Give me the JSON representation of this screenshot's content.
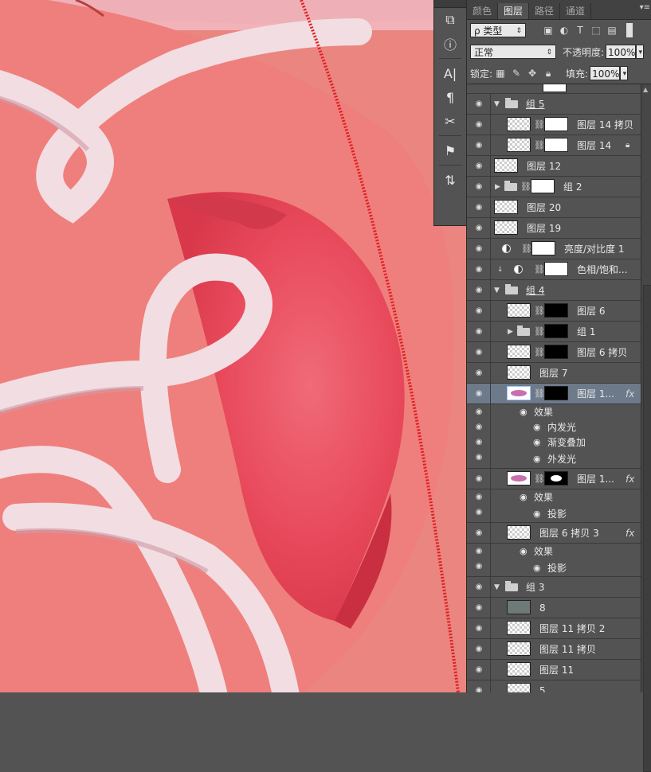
{
  "tabs": [
    "颜色",
    "图层",
    "路径",
    "通道"
  ],
  "active_tab": "图层",
  "filter": {
    "label": "ρ 类型"
  },
  "blend_mode": "正常",
  "opacity": {
    "label": "不透明度:",
    "value": "100%"
  },
  "lock": {
    "label": "锁定:"
  },
  "fill": {
    "label": "填充:",
    "value": "100%"
  },
  "layers": [
    {
      "name": "组 5"
    },
    {
      "name": "图层 14 拷贝"
    },
    {
      "name": "图层 14"
    },
    {
      "name": "图层 12"
    },
    {
      "name": "组 2"
    },
    {
      "name": "图层 20"
    },
    {
      "name": "图层 19"
    },
    {
      "name": "亮度/对比度 1"
    },
    {
      "name": "色相/饱和..."
    },
    {
      "name": "组 4"
    },
    {
      "name": "图层 6"
    },
    {
      "name": "组 1"
    },
    {
      "name": "图层 6 拷贝"
    },
    {
      "name": "图层 7"
    },
    {
      "name": "图层 1..."
    },
    {
      "name": "效果"
    },
    {
      "name": "内发光"
    },
    {
      "name": "渐变叠加"
    },
    {
      "name": "外发光"
    },
    {
      "name": "图层 1..."
    },
    {
      "name": "效果"
    },
    {
      "name": "投影"
    },
    {
      "name": "图层 6 拷贝 3"
    },
    {
      "name": "效果"
    },
    {
      "name": "投影"
    },
    {
      "name": "组 3"
    },
    {
      "name": "8"
    },
    {
      "name": "图层 11 拷贝 2"
    },
    {
      "name": "图层 11 拷贝"
    },
    {
      "name": "图层 11"
    },
    {
      "name": "5"
    }
  ],
  "fx_label": "fx",
  "colors": {
    "panel": "#535353",
    "selected": "#6d7a8a",
    "canvas_pink": "#e8837e",
    "ribbon": "#f3dde2",
    "red_dots": "#e02020"
  }
}
